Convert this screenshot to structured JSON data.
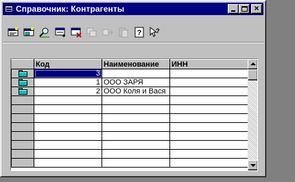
{
  "window": {
    "title": "Справочник: Контрагенты",
    "buttons": [
      "minimize",
      "maximize",
      "close"
    ],
    "close_label": "×"
  },
  "toolbar": {
    "icons": [
      {
        "name": "new-item-icon",
        "enabled": true
      },
      {
        "name": "new-group-icon",
        "enabled": true
      },
      {
        "name": "find-icon",
        "enabled": true
      },
      {
        "name": "add-line-icon",
        "enabled": true
      },
      {
        "name": "delete-icon",
        "enabled": true
      },
      {
        "name": "copy-icon",
        "enabled": false
      },
      {
        "name": "move-icon",
        "enabled": false
      },
      {
        "name": "paste-icon",
        "enabled": false
      },
      {
        "name": "help-icon",
        "enabled": true
      },
      {
        "name": "whats-this-icon",
        "enabled": true
      }
    ]
  },
  "table": {
    "columns": [
      "Код",
      "Наименование",
      "ИНН"
    ],
    "rows": [
      {
        "type": "folder",
        "code": "3",
        "name": "",
        "inn": "",
        "selected": true
      },
      {
        "type": "folder",
        "code": "1",
        "name": "ООО ЗАРЯ",
        "inn": "",
        "selected": false
      },
      {
        "type": "folder",
        "code": "2",
        "name": "ООО Коля и Вася",
        "inn": "",
        "selected": false
      },
      {
        "type": "empty",
        "code": "",
        "name": "",
        "inn": ""
      },
      {
        "type": "empty",
        "code": "",
        "name": "",
        "inn": ""
      },
      {
        "type": "empty",
        "code": "",
        "name": "",
        "inn": ""
      },
      {
        "type": "empty",
        "code": "",
        "name": "",
        "inn": ""
      },
      {
        "type": "empty",
        "code": "",
        "name": "",
        "inn": ""
      },
      {
        "type": "empty",
        "code": "",
        "name": "",
        "inn": ""
      },
      {
        "type": "empty",
        "code": "",
        "name": "",
        "inn": ""
      },
      {
        "type": "empty",
        "code": "",
        "name": "",
        "inn": ""
      }
    ]
  },
  "colors": {
    "titlebar": "#000080",
    "face": "#c0c0c0",
    "selection": "#000080",
    "folder": "#00c0c0",
    "desktop": "#808080"
  }
}
